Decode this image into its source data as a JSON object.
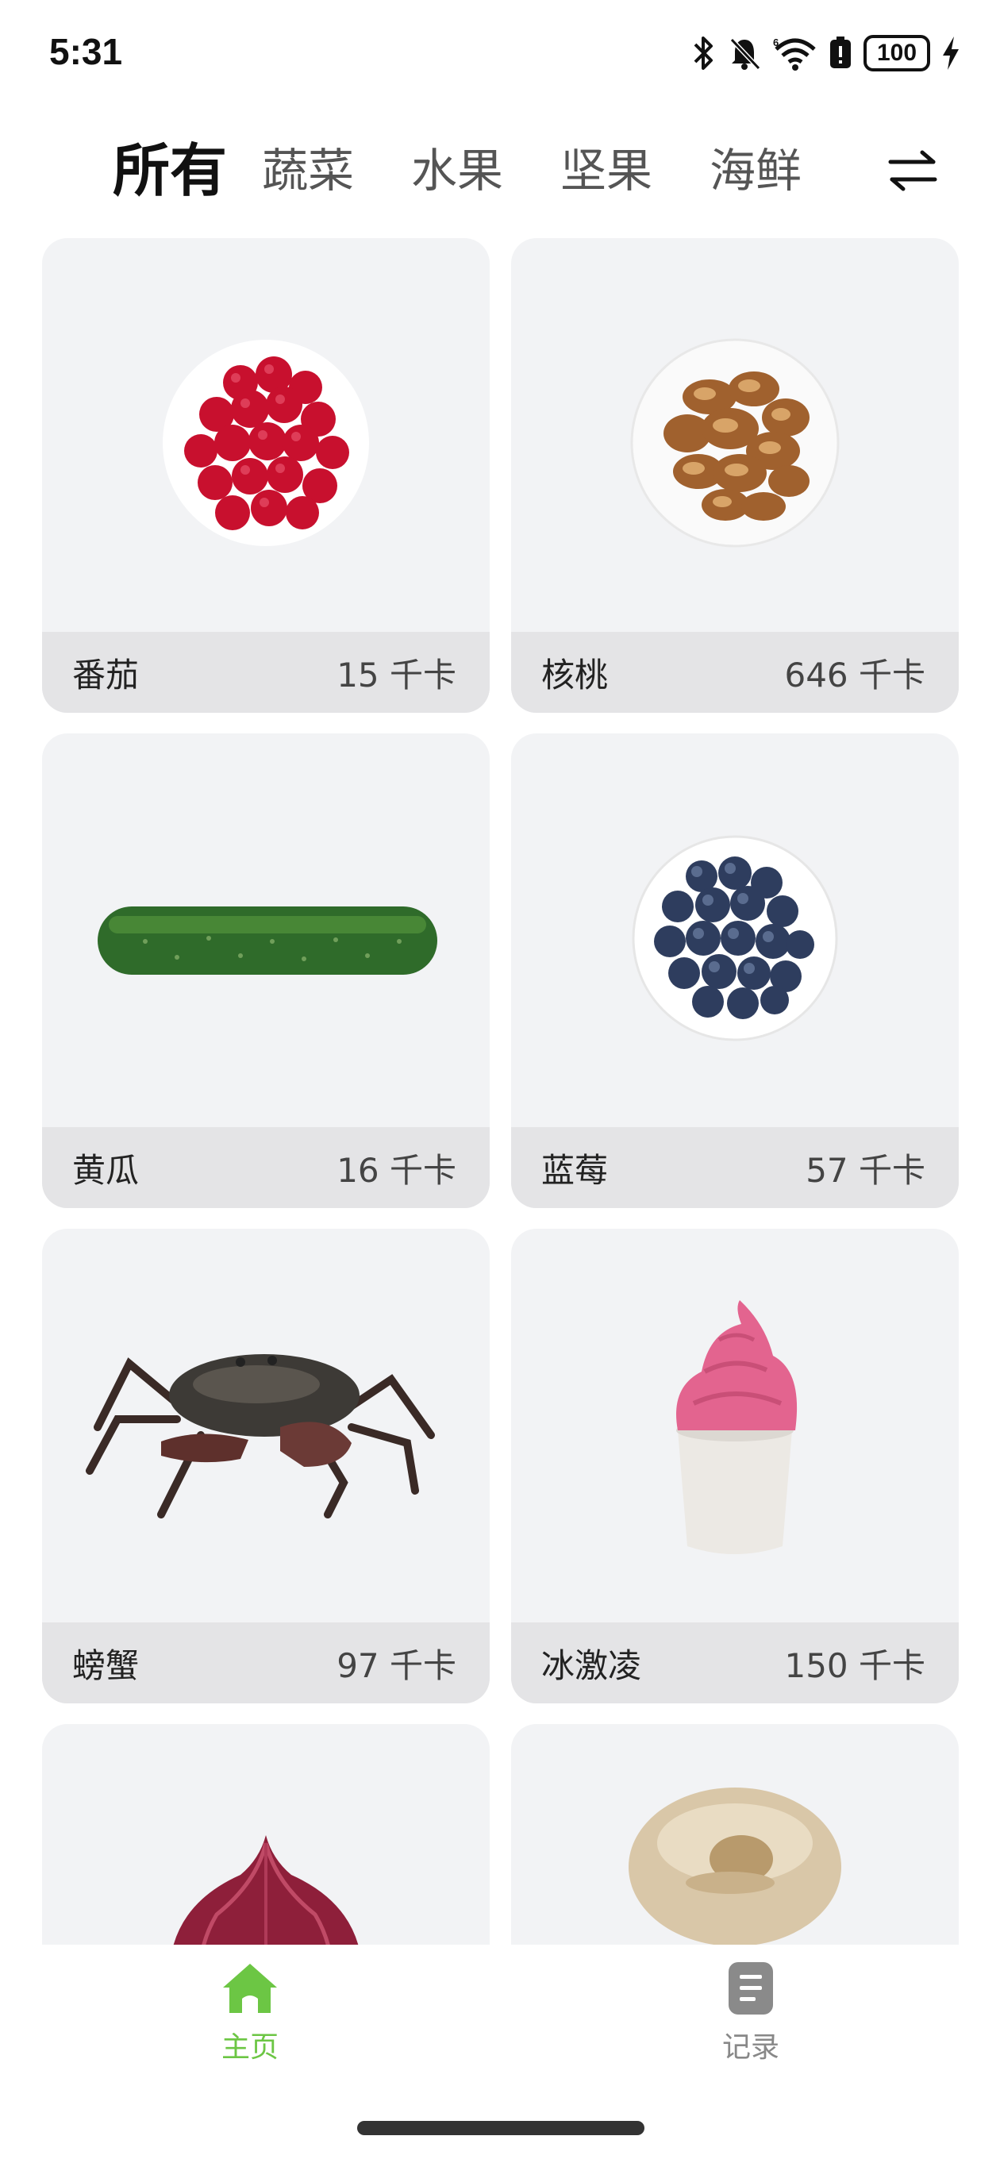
{
  "status_bar": {
    "time": "5:31",
    "battery": "100",
    "icons": [
      "bluetooth-icon",
      "mute-bell-icon",
      "wifi-6-icon",
      "battery-saver-icon",
      "charging-bolt-icon"
    ]
  },
  "tabs": [
    {
      "label": "所有",
      "active": true
    },
    {
      "label": "蔬菜",
      "active": false
    },
    {
      "label": "水果",
      "active": false
    },
    {
      "label": "坚果",
      "active": false
    },
    {
      "label": "海鲜",
      "active": false
    }
  ],
  "foods": [
    {
      "name": "番茄",
      "calories": "15 千卡",
      "image": "cranberries-bowl"
    },
    {
      "name": "核桃",
      "calories": "646 千卡",
      "image": "walnuts-bowl"
    },
    {
      "name": "黄瓜",
      "calories": "16 千卡",
      "image": "cucumber"
    },
    {
      "name": "蓝莓",
      "calories": "57 千卡",
      "image": "blueberries-bowl"
    },
    {
      "name": "螃蟹",
      "calories": "97 千卡",
      "image": "crab"
    },
    {
      "name": "冰激凌",
      "calories": "150 千卡",
      "image": "ice-cream-cup"
    },
    {
      "name": "",
      "calories": "",
      "image": "red-onion"
    },
    {
      "name": "",
      "calories": "",
      "image": "mushroom"
    }
  ],
  "bottom_nav": {
    "home_label": "主页",
    "record_label": "记录",
    "accent_color": "#6cc644",
    "inactive_color": "#888888"
  }
}
